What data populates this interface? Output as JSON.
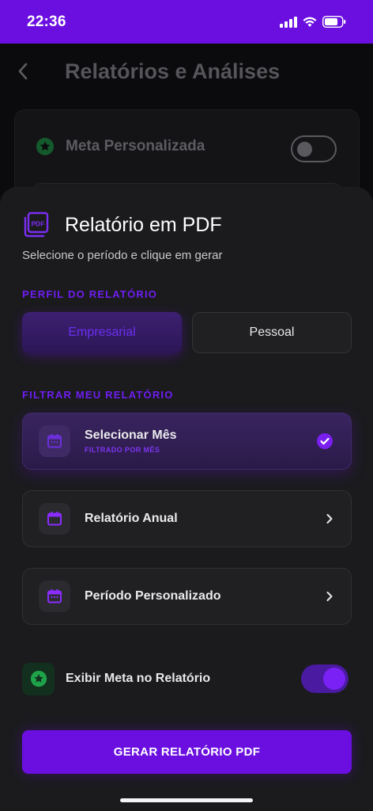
{
  "status_bar": {
    "time": "22:36"
  },
  "header": {
    "title": "Relatórios e Análises"
  },
  "background_card": {
    "meta_label": "Meta Personalizada",
    "toggle_on": false
  },
  "sheet": {
    "title": "Relatório em PDF",
    "subtitle": "Selecione o período e clique em gerar",
    "profile_section": {
      "label": "PERFIL DO RELATÓRIO",
      "options": [
        "Empresarial",
        "Pessoal"
      ],
      "selected": "Empresarial"
    },
    "filter_section": {
      "label": "FILTRAR MEU RELATÓRIO",
      "options": [
        {
          "label": "Selecionar Mês",
          "sublabel": "FILTRADO POR MÊS",
          "selected": true
        },
        {
          "label": "Relatório Anual",
          "selected": false
        },
        {
          "label": "Período Personalizado",
          "selected": false
        }
      ]
    },
    "meta_toggle": {
      "label": "Exibir Meta no Relatório",
      "on": true
    },
    "generate_button": "GERAR RELATÓRIO PDF"
  },
  "colors": {
    "accent": "#6a0fe0",
    "background": "#0b0b0d",
    "sheet": "#1b1b1e",
    "green": "#1ea34a"
  }
}
